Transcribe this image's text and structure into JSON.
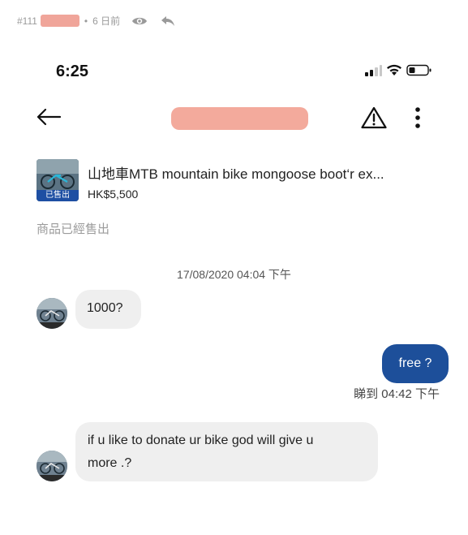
{
  "post_meta": {
    "number": "#111",
    "redacted_name": "",
    "separator": "•",
    "time_ago": "6 日前"
  },
  "status_bar": {
    "time": "6:25"
  },
  "nav": {
    "title_redacted": ""
  },
  "product": {
    "title": "山地車MTB mountain bike mongoose boot‘r ex...",
    "price": "HK$5,500",
    "badge": "已售出"
  },
  "sold_note": "商品已經售出",
  "date_separator": "17/08/2020 04:04 下午",
  "messages": [
    {
      "direction": "in",
      "text": "1000?"
    },
    {
      "direction": "out",
      "text": "free ?"
    },
    {
      "direction": "in",
      "lines": [
        "if u like to donate ur bike god will give u",
        "more .?"
      ]
    }
  ],
  "read_receipt": "睇到 04:42 下午",
  "colors": {
    "accent": "#1d4f9a",
    "incoming_bubble": "#efefef",
    "redaction": "#f3aa9c"
  },
  "icons": [
    "eye-icon",
    "reply-icon",
    "signal-icon",
    "wifi-icon",
    "battery-icon",
    "back-arrow-icon",
    "warning-icon",
    "more-vertical-icon"
  ]
}
